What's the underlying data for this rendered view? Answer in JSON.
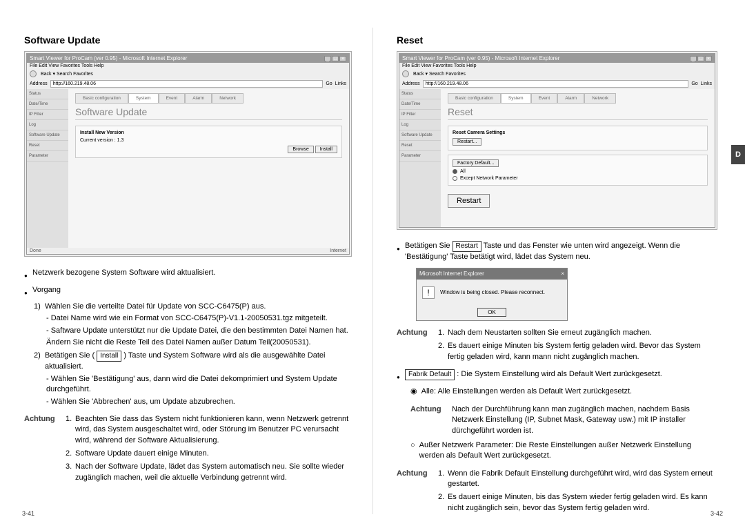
{
  "sideTab": "D",
  "left": {
    "title": "Software Update",
    "pageNum": "3-41",
    "ie": {
      "title": "Smart Viewer for ProCam (ver 0.95) - Microsoft Internet Explorer",
      "menu": "File   Edit   View   Favorites   Tools   Help",
      "toolbar": "Back  ▾        Search   Favorites",
      "addrLabel": "Address",
      "addr": "http://160.219.48.06",
      "go": "Go",
      "links": "Links",
      "statusDone": "Done",
      "statusNet": "Internet"
    },
    "app": {
      "sidebar": [
        "Status",
        "Date/Time",
        "IP Filter",
        "Log",
        "Software Update",
        "Reset",
        "Parameter"
      ],
      "tabs": [
        "Basic configuration",
        "System",
        "Event",
        "Alarm",
        "Network"
      ],
      "h1": "Software Update",
      "panelTitle": "Install New Version",
      "currentVersion": "Current version : 1.3",
      "btnBrowse": "Browse",
      "btnInstall": "Install"
    },
    "body": {
      "b1": "Netzwerk bezogene System Software wird aktualisiert.",
      "b2": "Vorgang",
      "s1": "Wählen Sie die verteilte Datei für Update von SCC-C6475(P) aus.",
      "s1a": "- Datei Name wird wie ein Format von SCC-C6475(P)-V1.1-20050531.tgz mitgeteilt.",
      "s1b": "- Saftware Update unterstützt nur die Update Datei, die den bestimmten Datei Namen hat.",
      "s1c": "Ändern Sie nicht die Reste Teil des Datei Namen außer Datum Teil(20050531).",
      "s2a": "Betätigen Sie (",
      "s2btn": "Install",
      "s2b": ") Taste und System Software wird als die ausgewählte Datei aktualisiert.",
      "s2c": "- Wählen Sie 'Bestätigung' aus, dann wird die Datei dekomprimiert und System Update durchgeführt.",
      "s2d": "- Wählen Sie 'Abbrechen' aus, um Update abzubrechen.",
      "achtungLabel": "Achtung",
      "a1": "Beachten Sie dass das System nicht funktionieren kann, wenn Netzwerk getrennt wird, das System ausgeschaltet wird, oder Störung im Benutzer PC verursacht wird, während der Software Aktualisierung.",
      "a2": "Software Update dauert einige Minuten.",
      "a3": "Nach der Software Update, lädet das System automatisch neu. Sie sollte wieder zugänglich machen, weil die aktuelle Verbindung getrennt wird."
    }
  },
  "right": {
    "title": "Reset",
    "pageNum": "3-42",
    "ie": {
      "title": "Smart Viewer for ProCam (ver 0.95) - Microsoft Internet Explorer",
      "addr": "http://160.219.48.06"
    },
    "app": {
      "h1": "Reset",
      "panel1Title": "Reset Camera Settings",
      "btnRestart": "Restart...",
      "btnFactory": "Factory Default...",
      "radioAll": "All",
      "radioExcept": "Except Network Parameter",
      "btnRestartBig": "Restart"
    },
    "body": {
      "l1a": "Betätigen Sie ",
      "l1btn": "Restart",
      "l1b": " Taste und das Fenster wie unten wird angezeigt. Wenn die 'Bestätigung' Taste betätigt wird, lädet das System neu.",
      "dlgTitle": "Microsoft Internet Explorer",
      "dlgMsg": "Window is being closed. Please reconnect.",
      "dlgOk": "OK",
      "achtungLabel": "Achtung",
      "a1": "Nach dem Neustarten sollten Sie erneut zugänglich machen.",
      "a2": "Es dauert einige Minuten bis System fertig geladen wird. Bevor das System fertig geladen wird, kann mann nicht zugänglich machen.",
      "l2btn": "Fabrik Default",
      "l2b": " : Die System Einstellung wird als Default Wert zurückgesetzt.",
      "circ1": "Alle: Alle Einstellungen werden als Default Wert zurückgesetzt.",
      "a3": "Nach der Durchführung kann man zugänglich machen, nachdem Basis Netzwerk Einstellung (IP, Subnet Mask, Gateway usw.) mit IP installer dürchgeführt worden ist.",
      "circ2": "Außer Netzwerk Parameter: Die Reste Einstellungen außer Netzwerk Einstellung werden als Default Wert zurückgesetzt.",
      "a4": "Wenn die Fabrik Default Einstellung durchgeführt wird, wird das System erneut gestartet.",
      "a5": "Es dauert einige Minuten, bis das System wieder fertig geladen wird. Es kann nicht zugänglich sein, bevor das System fertig geladen wird."
    }
  }
}
